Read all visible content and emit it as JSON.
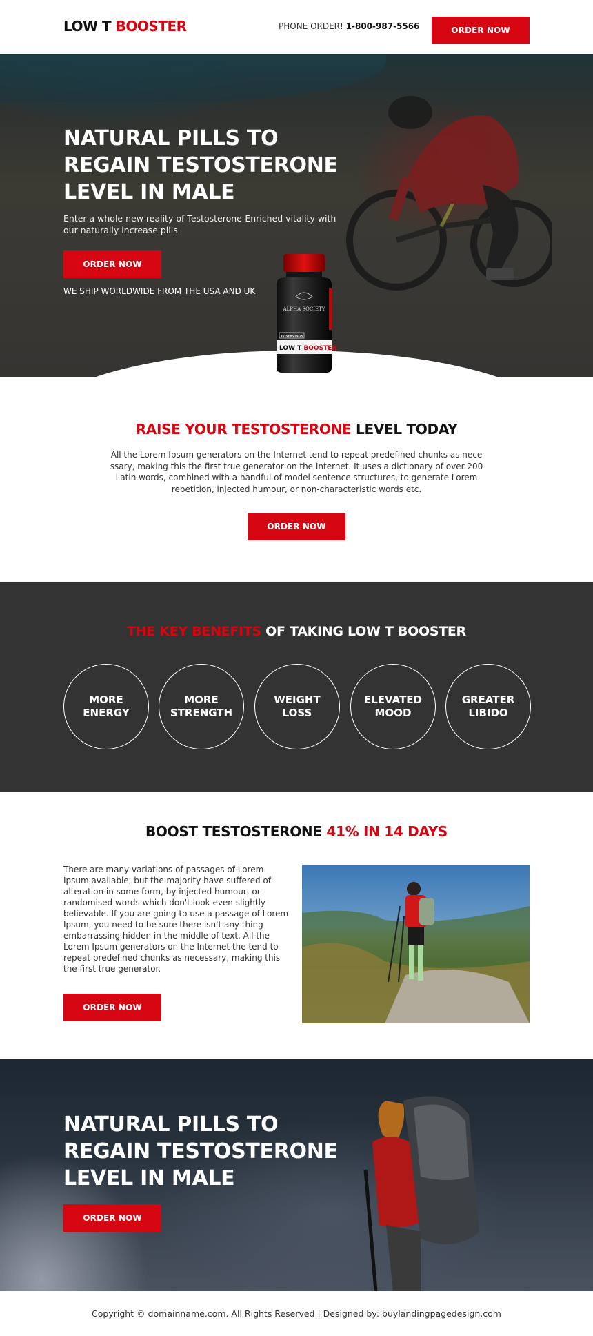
{
  "header": {
    "logo_part1": "LOW T ",
    "logo_part2": "BOOSTER",
    "phone_label": "PHONE ORDER! ",
    "phone_number": "1-800-987-5566",
    "order_button": "ORDER NOW"
  },
  "hero": {
    "title": "NATURAL PILLS TO REGAIN TESTOSTERONE LEVEL IN MALE",
    "subtitle": "Enter a whole new reality of Testosterone-Enriched vitality with our naturally increase pills",
    "order_button": "ORDER NOW",
    "shipping_note": "WE SHIP WORLDWIDE FROM THE USA AND UK",
    "product": {
      "brand": "ALPHA SOCIETY",
      "servings": "30 SERVINGS",
      "label_part1": "LOW T ",
      "label_part2": "BOOSTER"
    }
  },
  "raise": {
    "title_red": "RAISE YOUR TESTOSTERONE",
    "title_dark": " LEVEL TODAY",
    "body": "All the Lorem Ipsum generators on the Internet tend to repeat predefined chunks as nece ssary, making this the first true generator on the Internet. It uses a dictionary of over 200 Latin words, combined with a handful of model sentence structures, to generate Lorem repetition, injected humour, or non-characteristic words etc.",
    "order_button": "ORDER NOW"
  },
  "benefits": {
    "title_red": "THE KEY BENEFITS",
    "title_white": " OF TAKING LOW T BOOSTER",
    "items": [
      {
        "line1": "MORE",
        "line2": "ENERGY"
      },
      {
        "line1": "MORE",
        "line2": "STRENGTH"
      },
      {
        "line1": "WEIGHT",
        "line2": "LOSS"
      },
      {
        "line1": "ELEVATED",
        "line2": "MOOD"
      },
      {
        "line1": "GREATER",
        "line2": "LIBIDO"
      }
    ]
  },
  "boost": {
    "title_dark": "BOOST TESTOSTERONE ",
    "title_red": "41% IN 14 DAYS",
    "body": "There are many variations of passages of Lorem Ipsum available, but the majority have suffered of alteration in some form, by injected humour, or randomised words which don't look even slightly believable. If you are going to use a passage of Lorem Ipsum, you need to be sure there isn't any thing embarrassing hidden in the middle of text. All the Lorem Ipsum generators on the Internet the tend to repeat predefined chunks as necessary, making this the first true generator.",
    "order_button": "ORDER NOW"
  },
  "hero2": {
    "title": "NATURAL PILLS TO REGAIN TESTOSTERONE LEVEL IN MALE",
    "order_button": "ORDER NOW"
  },
  "footer": {
    "text": "Copyright © domainname.com. All Rights Reserved | Designed by: buylandingpagedesign.com"
  },
  "colors": {
    "accent_red": "#d50511",
    "dark_section": "#333333",
    "text_dark": "#111111"
  }
}
